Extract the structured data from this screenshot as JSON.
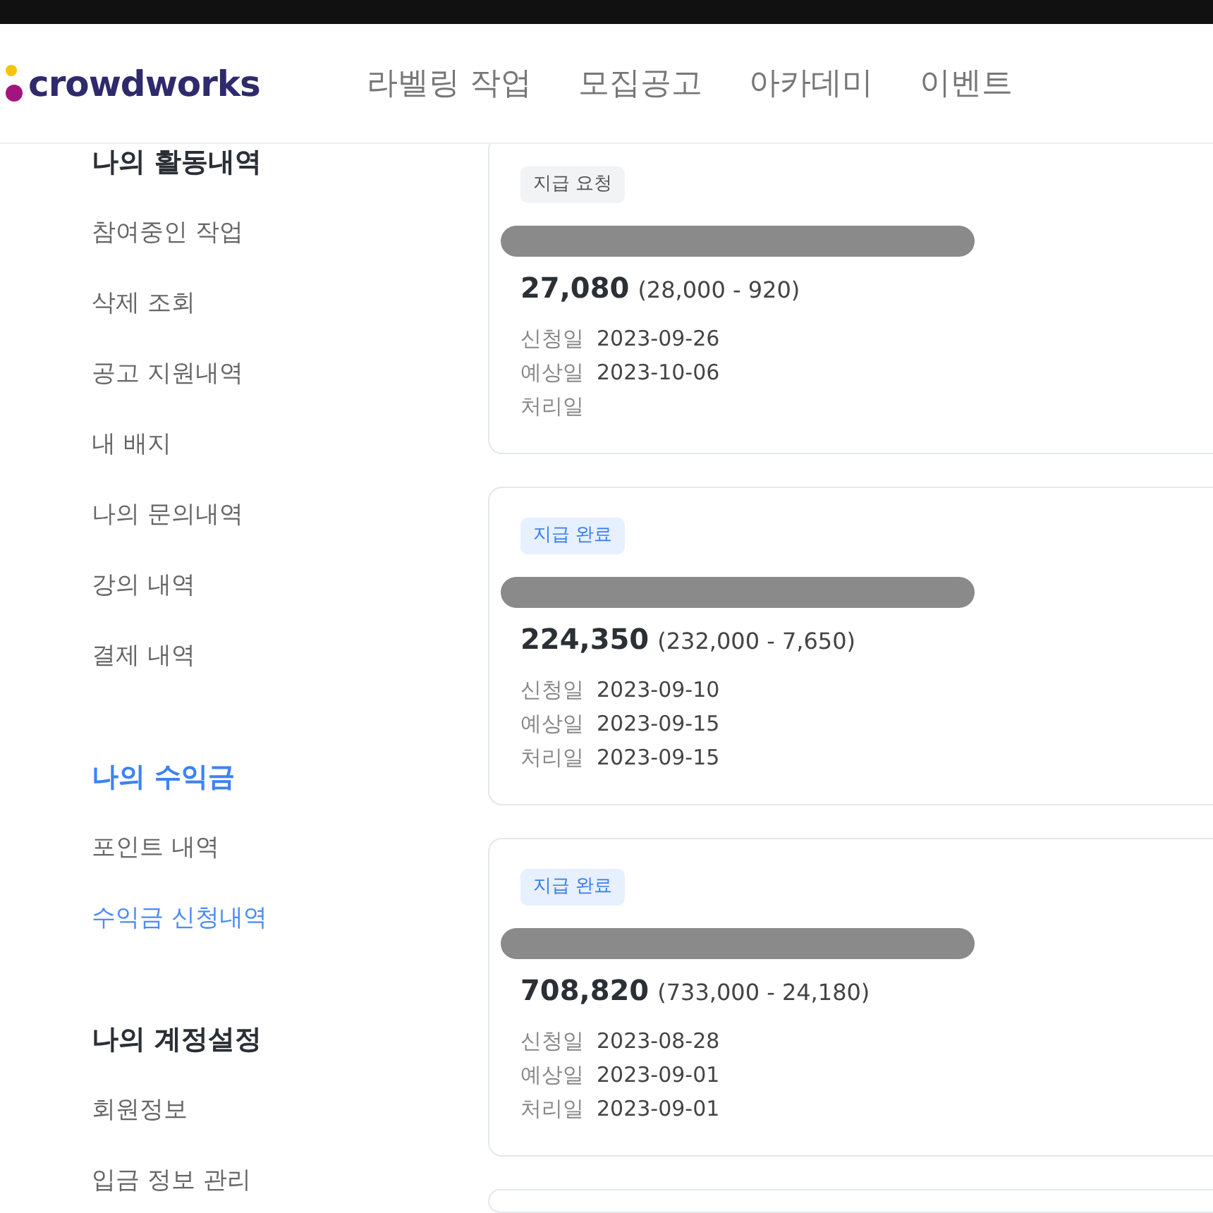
{
  "header": {
    "logo": "crowdworks",
    "nav": [
      "라벨링 작업",
      "모집공고",
      "아카데미",
      "이벤트"
    ]
  },
  "sidebar": {
    "sections": [
      {
        "title": "나의 활동내역",
        "active": false,
        "items": [
          {
            "label": "참여중인 작업",
            "selected": false
          },
          {
            "label": "삭제 조회",
            "selected": false
          },
          {
            "label": "공고 지원내역",
            "selected": false
          },
          {
            "label": "내 배지",
            "selected": false
          },
          {
            "label": "나의 문의내역",
            "selected": false
          },
          {
            "label": "강의 내역",
            "selected": false
          },
          {
            "label": "결제 내역",
            "selected": false
          }
        ]
      },
      {
        "title": "나의 수익금",
        "active": true,
        "items": [
          {
            "label": "포인트 내역",
            "selected": false
          },
          {
            "label": "수익금 신청내역",
            "selected": true
          }
        ]
      },
      {
        "title": "나의 계정설정",
        "active": false,
        "items": [
          {
            "label": "회원정보",
            "selected": false
          },
          {
            "label": "입금 정보 관리",
            "selected": false
          }
        ]
      }
    ]
  },
  "payouts": [
    {
      "status": {
        "kind": "requested",
        "label": "지급 요청"
      },
      "amount": "27,080",
      "breakdown": "(28,000 - 920)",
      "dates": [
        {
          "label": "신청일",
          "value": "2023-09-26"
        },
        {
          "label": "예상일",
          "value": "2023-10-06"
        },
        {
          "label": "처리일"
        }
      ]
    },
    {
      "status": {
        "kind": "done",
        "label": "지급 완료"
      },
      "amount": "224,350",
      "breakdown": "(232,000 - 7,650)",
      "dates": [
        {
          "label": "신청일",
          "value": "2023-09-10"
        },
        {
          "label": "예상일",
          "value": "2023-09-15"
        },
        {
          "label": "처리일",
          "value": "2023-09-15"
        }
      ]
    },
    {
      "status": {
        "kind": "done",
        "label": "지급 완료"
      },
      "amount": "708,820",
      "breakdown": "(733,000 - 24,180)",
      "dates": [
        {
          "label": "신청일",
          "value": "2023-08-28"
        },
        {
          "label": "예상일",
          "value": "2023-09-01"
        },
        {
          "label": "처리일",
          "value": "2023-09-01"
        }
      ]
    }
  ]
}
